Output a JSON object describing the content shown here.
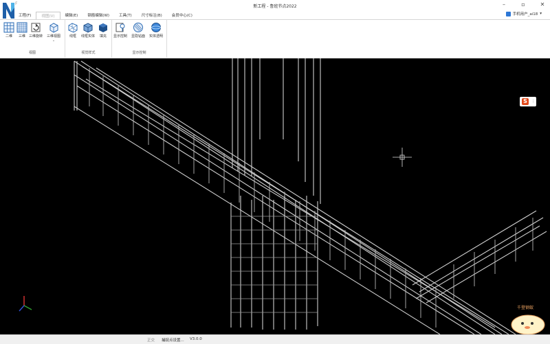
{
  "app": {
    "title": "新工程 - 鲁班节点2022",
    "quick_access": "F"
  },
  "menu": [
    {
      "label": "工程(F)"
    },
    {
      "label": "视图(V)"
    },
    {
      "label": "编辑(E)"
    },
    {
      "label": "钢筋编辑(W)"
    },
    {
      "label": "工具(T)"
    },
    {
      "label": "尺寸标注(B)"
    },
    {
      "label": "会员中心(C)"
    }
  ],
  "user": {
    "label": "手机用户_ai18"
  },
  "ribbon": {
    "groups": [
      {
        "label": "视图",
        "buttons": [
          {
            "label": "二维",
            "icon": "grid-2d-icon"
          },
          {
            "label": "三维",
            "icon": "grid-3d-icon"
          },
          {
            "label": "三维旋转",
            "icon": "rotate-3d-icon"
          },
          {
            "label": "三维视图",
            "icon": "cube-view-icon"
          }
        ]
      },
      {
        "label": "视觉样式",
        "buttons": [
          {
            "label": "线框",
            "icon": "wireframe-icon"
          },
          {
            "label": "线框实体",
            "icon": "wireframe-solid-icon"
          },
          {
            "label": "填充",
            "icon": "solid-fill-icon"
          }
        ]
      },
      {
        "label": "显示控制",
        "buttons": [
          {
            "label": "显示控制",
            "icon": "display-control-icon"
          },
          {
            "label": "显隐钻面",
            "icon": "hatch-sphere-icon"
          },
          {
            "label": "实体透明",
            "icon": "transparent-sphere-icon"
          }
        ]
      }
    ]
  },
  "status": {
    "mode": "正交",
    "snap": "捕捉点设置...",
    "version": "V3.0.0"
  },
  "overlay": {
    "badge": "S",
    "mascot_text": "千登钢蚁"
  },
  "colors": {
    "accent": "#2d77d6",
    "viewport_bg": "#000000",
    "rebar": "#cfcfcf"
  }
}
